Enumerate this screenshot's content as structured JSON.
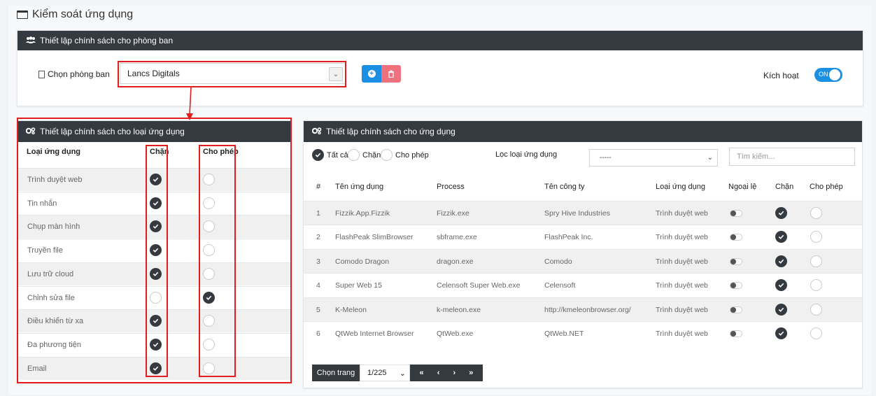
{
  "page_title": "Kiểm soát ứng dụng",
  "dept_panel": {
    "title": "Thiết lập chính sách cho phòng ban",
    "select_label": "Chọn phòng ban",
    "selected_dept": "Lancs Digitals",
    "activate_label": "Kích hoạt",
    "activate_state": "ON"
  },
  "category_panel": {
    "title": "Thiết lập chính sách cho loại ứng dụng",
    "headers": {
      "type": "Loại ứng dụng",
      "block": "Chặn",
      "allow": "Cho phép"
    },
    "rows": [
      {
        "name": "Trình duyệt web",
        "block": true
      },
      {
        "name": "Tin nhắn",
        "block": true
      },
      {
        "name": "Chụp màn hình",
        "block": true
      },
      {
        "name": "Truyền file",
        "block": true
      },
      {
        "name": "Lưu trữ cloud",
        "block": true
      },
      {
        "name": "Chỉnh sửa file",
        "block": false
      },
      {
        "name": "Điều khiển từ xa",
        "block": true
      },
      {
        "name": "Đa phương tiện",
        "block": true
      },
      {
        "name": "Email",
        "block": true
      }
    ]
  },
  "app_panel": {
    "title": "Thiết lập chính sách cho ứng dụng",
    "filters": {
      "all": "Tất cả",
      "block": "Chặn",
      "allow": "Cho phép",
      "selected": "all"
    },
    "type_filter_label": "Lọc loại ứng dụng",
    "type_filter_value": "-----",
    "search_placeholder": "Tìm kiếm...",
    "columns": {
      "num": "#",
      "name": "Tên ứng dụng",
      "process": "Process",
      "company": "Tên công ty",
      "type": "Loại ứng dụng",
      "exception": "Ngoại lệ",
      "block": "Chặn",
      "allow": "Cho phép"
    },
    "rows": [
      {
        "num": "1",
        "name": "Fizzik.App.Fizzik",
        "process": "Fizzik.exe",
        "company": "Spry Hive Industries",
        "type": "Trình duyệt web",
        "block": true
      },
      {
        "num": "2",
        "name": "FlashPeak SlimBrowser",
        "process": "sbframe.exe",
        "company": "FlashPeak Inc.",
        "type": "Trình duyệt web",
        "block": true
      },
      {
        "num": "3",
        "name": "Comodo Dragon",
        "process": "dragon.exe",
        "company": "Comodo",
        "type": "Trình duyệt web",
        "block": true
      },
      {
        "num": "4",
        "name": "Super Web 15",
        "process": "Celensoft Super Web.exe",
        "company": "Celensoft",
        "type": "Trình duyệt web",
        "block": true
      },
      {
        "num": "5",
        "name": "K-Meleon",
        "process": "k-meleon.exe",
        "company": "http://kmeleonbrowser.org/",
        "type": "Trình duyệt web",
        "block": true
      },
      {
        "num": "6",
        "name": "QtWeb Internet Browser",
        "process": "QtWeb.exe",
        "company": "QtWeb.NET",
        "type": "Trình duyệt web",
        "block": true
      }
    ],
    "pager": {
      "label": "Chọn trang",
      "current": "1/225",
      "buttons": [
        "«",
        "‹",
        "›",
        "»"
      ]
    }
  },
  "colors": {
    "dark": "#343a40",
    "primary": "#1a8fe3",
    "danger": "#f0717e",
    "highlight": "#e21d1d"
  }
}
